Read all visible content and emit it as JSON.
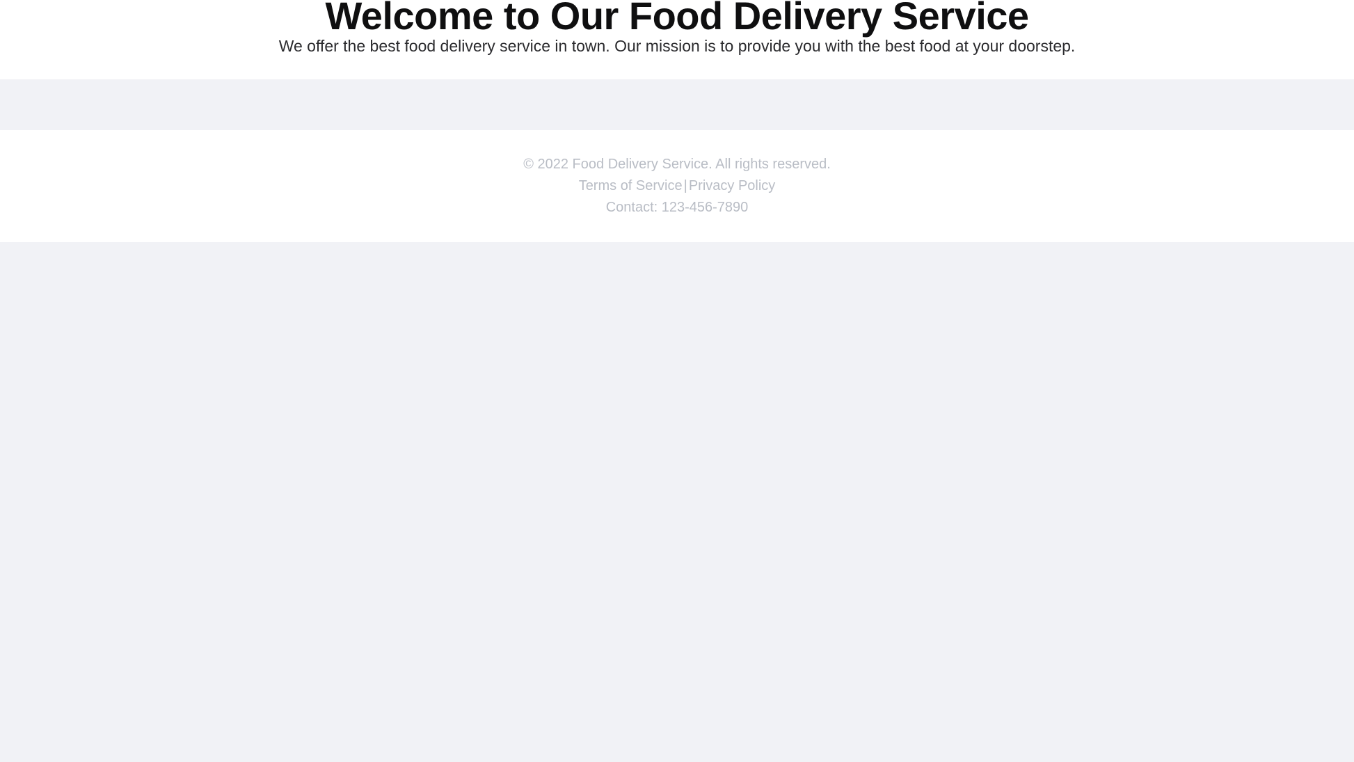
{
  "header": {
    "title": "Welcome to Our Food Delivery Service",
    "subtitle": "We offer the best food delivery service in town. Our mission is to provide you with the best food at your doorstep."
  },
  "main": {
    "content": ""
  },
  "footer": {
    "copyright": "© 2022 Food Delivery Service. All rights reserved.",
    "terms_label": "Terms of Service",
    "separator": "|",
    "privacy_label": "Privacy Policy",
    "contact": "Contact: 123-456-7890"
  },
  "colors": {
    "page_background": "#f1f2f6",
    "surface": "#ffffff",
    "title_text": "#0f0f10",
    "subtitle_text": "#2b2b2e",
    "footer_text": "#b9bdc5"
  }
}
